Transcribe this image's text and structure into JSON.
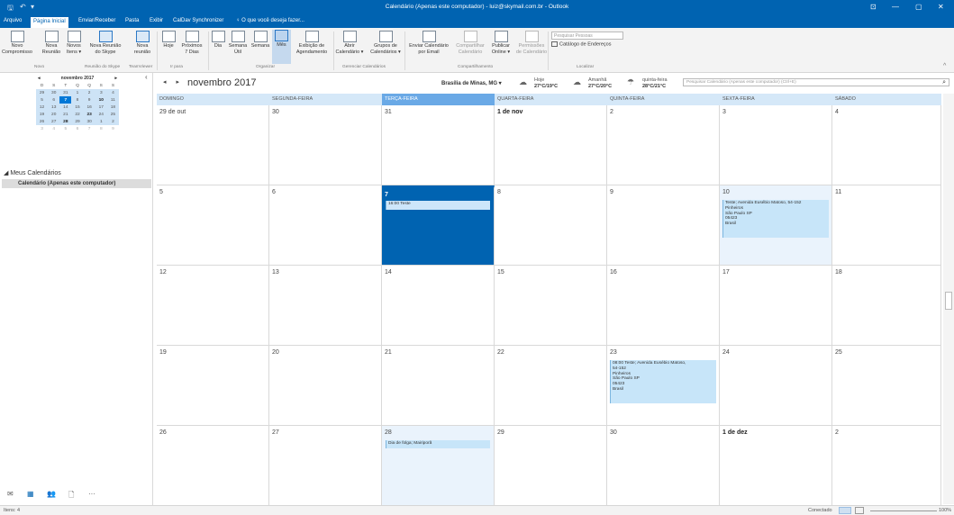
{
  "titlebar": {
    "title": "Calendário (Apenas este computador) - luiz@skymail.com.br - Outlook",
    "qa_save": "🖫",
    "qa_undo": "↶",
    "qa_more": "▾",
    "win_opts": "⊡",
    "win_min": "—",
    "win_max": "▢",
    "win_close": "✕"
  },
  "tabs": [
    "Arquivo",
    "Página Inicial",
    "Enviar/Receber",
    "Pasta",
    "Exibir",
    "CalDav Synchronizer",
    "♀ O que você deseja fazer..."
  ],
  "ribbon": {
    "buttons": [
      {
        "label": "Novo\nCompromisso",
        "icon": "calendar-new-icon"
      },
      {
        "label": "Nova\nReunião",
        "icon": "meeting-new-icon"
      },
      {
        "label": "Novos\nItens ▾",
        "icon": "new-items-icon"
      },
      {
        "label": "Nova Reunião\ndo Skype",
        "icon": "skype-icon"
      },
      {
        "label": "Nova\nreunião",
        "icon": "teamviewer-icon"
      },
      {
        "label": "Hoje",
        "icon": "today-icon"
      },
      {
        "label": "Próximos\n7 Dias",
        "icon": "next7-icon"
      },
      {
        "label": "Dia",
        "icon": "day-view-icon"
      },
      {
        "label": "Semana\nÚtil",
        "icon": "workweek-view-icon"
      },
      {
        "label": "Semana",
        "icon": "week-view-icon"
      },
      {
        "label": "Mês",
        "icon": "month-view-icon"
      },
      {
        "label": "Exibição de\nAgendamento",
        "icon": "schedule-view-icon"
      },
      {
        "label": "Abrir\nCalendário ▾",
        "icon": "open-calendar-icon"
      },
      {
        "label": "Grupos de\nCalendários ▾",
        "icon": "calendar-groups-icon"
      },
      {
        "label": "Enviar Calendário\npor Email",
        "icon": "email-calendar-icon"
      },
      {
        "label": "Compartilhar\nCalendário",
        "icon": "share-calendar-icon"
      },
      {
        "label": "Publicar\nOnline ▾",
        "icon": "publish-online-icon"
      },
      {
        "label": "Permissões\nde Calendário",
        "icon": "permissions-icon"
      }
    ],
    "groups": [
      "Novo",
      "Reunião do Skype",
      "TeamViewer",
      "Ir para",
      "Organizar",
      "Gerenciar Calendários",
      "Compartilhamento",
      "Localizar"
    ],
    "search_people_placeholder": "Pesquisar Pessoas",
    "address_book": "Catálogo de Endereços",
    "collapse": "^"
  },
  "minical": {
    "title": "novembro 2017",
    "prev": "◂",
    "next": "▸",
    "weekdays": [
      "D",
      "S",
      "T",
      "Q",
      "Q",
      "S",
      "S"
    ],
    "weeks": [
      [
        "29",
        "30",
        "31",
        "1",
        "2",
        "3",
        "4"
      ],
      [
        "5",
        "6",
        "7",
        "8",
        "9",
        "10",
        "11"
      ],
      [
        "12",
        "13",
        "14",
        "15",
        "16",
        "17",
        "18"
      ],
      [
        "19",
        "20",
        "21",
        "22",
        "23",
        "24",
        "25"
      ],
      [
        "26",
        "27",
        "28",
        "29",
        "30",
        "1",
        "2"
      ],
      [
        "3",
        "4",
        "5",
        "6",
        "7",
        "8",
        "9"
      ]
    ],
    "collapse": "‹"
  },
  "folders": {
    "group": "◢ Meus Calendários",
    "item": "Calendário (Apenas este computador)"
  },
  "bottomnav": [
    "✉",
    "▦",
    "👥",
    "🗋",
    "···"
  ],
  "calendar": {
    "prev": "◂",
    "next": "▸",
    "month_title": "novembro 2017",
    "location": "Brasília de Minas, MG ▾",
    "weather": [
      {
        "day": "Hoje",
        "temp": "27°C/19°C",
        "icon": "cloud-icon"
      },
      {
        "day": "Amanhã",
        "temp": "27°C/20°C",
        "icon": "cloud-icon"
      },
      {
        "day": "quinta-feira",
        "temp": "28°C/21°C",
        "icon": "rain-icon"
      }
    ],
    "search_placeholder": "Pesquisar Calendário (Apenas este computador) (Ctrl+E)",
    "search_icon": "⌕",
    "day_headers": [
      "DOMINGO",
      "SEGUNDA-FEIRA",
      "TERÇA-FEIRA",
      "QUARTA-FEIRA",
      "QUINTA-FEIRA",
      "SEXTA-FEIRA",
      "SÁBADO"
    ],
    "weeks": [
      [
        "29 de out",
        "30",
        "31",
        "1 de nov",
        "2",
        "3",
        "4"
      ],
      [
        "5",
        "6",
        "7",
        "8",
        "9",
        "10",
        "11"
      ],
      [
        "12",
        "13",
        "14",
        "15",
        "16",
        "17",
        "18"
      ],
      [
        "19",
        "20",
        "21",
        "22",
        "23",
        "24",
        "25"
      ],
      [
        "26",
        "27",
        "28",
        "29",
        "30",
        "1 de dez",
        "2"
      ]
    ],
    "events": {
      "e1": "16:00 Teste",
      "e2": "Teste; Avenida Eusébio Matoso, 54-152\nPinheiros\nSão Paulo SP\n05423\nBrasil",
      "e3": "08:00 Teste; Avenida Eusébio Matoso,\n54-152\nPinheiros\nSão Paulo SP\n05423\nBrasil",
      "e4": "Dia de folga; Mairiporã"
    }
  },
  "status": {
    "items": "Itens: 4",
    "connected": "Conectado",
    "zoom": "100%"
  },
  "colors": {
    "accent": "#0063b1",
    "today_header": "#6aa9e6",
    "event": "#c7e5f9"
  }
}
